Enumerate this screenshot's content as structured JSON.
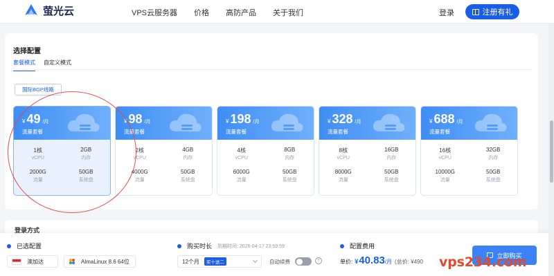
{
  "header": {
    "brand": "萤光云",
    "nav": [
      "VPS云服务器",
      "价格",
      "高防产品",
      "关于我们"
    ],
    "login": "登录",
    "register": "注册有礼"
  },
  "config": {
    "title": "选择配置",
    "tabs": [
      "套餐模式",
      "自定义模式"
    ],
    "active_tab": 0,
    "route": "国际BGP线路"
  },
  "plans": [
    {
      "price": "49",
      "unit": "/月",
      "type": "流量套餐",
      "cpu": "1核",
      "cpu_label": "vCPU",
      "ram": "2GB",
      "ram_label": "内存",
      "traffic": "2000G",
      "traffic_label": "流量",
      "disk": "50GB",
      "disk_label": "系统盘",
      "selected": true
    },
    {
      "price": "98",
      "unit": "/月",
      "type": "流量套餐",
      "cpu": "2核",
      "cpu_label": "vCPU",
      "ram": "4GB",
      "ram_label": "内存",
      "traffic": "4000G",
      "traffic_label": "流量",
      "disk": "50GB",
      "disk_label": "系统盘",
      "selected": false
    },
    {
      "price": "198",
      "unit": "/月",
      "type": "流量套餐",
      "cpu": "4核",
      "cpu_label": "vCPU",
      "ram": "8GB",
      "ram_label": "内存",
      "traffic": "6000G",
      "traffic_label": "流量",
      "disk": "50GB",
      "disk_label": "系统盘",
      "selected": false
    },
    {
      "price": "328",
      "unit": "/月",
      "type": "流量套餐",
      "cpu": "8核",
      "cpu_label": "vCPU",
      "ram": "16GB",
      "ram_label": "内存",
      "traffic": "8000G",
      "traffic_label": "流量",
      "disk": "50GB",
      "disk_label": "系统盘",
      "selected": false
    },
    {
      "price": "688",
      "unit": "/月",
      "type": "流量套餐",
      "cpu": "16核",
      "cpu_label": "vCPU",
      "ram": "32GB",
      "ram_label": "内存",
      "traffic": "10000G",
      "traffic_label": "流量",
      "disk": "50GB",
      "disk_label": "系统盘",
      "selected": false
    }
  ],
  "currency": "¥",
  "next_section": "登录方式",
  "bottom": {
    "selected_title": "已选配置",
    "region": "澳加达",
    "os": "AlmaLinux 8.6 64位",
    "duration_title": "购买时长",
    "deadline": "到期时间: 2026-04-17 23:59:59",
    "duration": "12个月",
    "duration_tag": "买十送二",
    "auto_renew": "自动续费",
    "help": "?",
    "fee_title": "配置费用",
    "unit_price_label": "单价:",
    "price": "40.83",
    "price_unit": "/月",
    "total": "(总价: ¥490",
    "buy": "立即购买"
  },
  "watermark": "vps234.com",
  "colors": {
    "accent": "#1a5ee8",
    "annotation": "#e04c4c",
    "watermark": "#e14a2c"
  }
}
